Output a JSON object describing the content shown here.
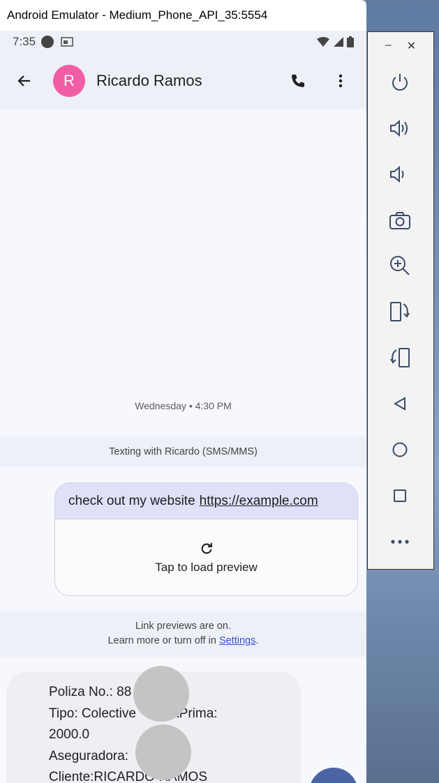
{
  "window": {
    "title": "Android Emulator - Medium_Phone_API_35:5554"
  },
  "status_bar": {
    "time": "7:35"
  },
  "app_bar": {
    "avatar_letter": "R",
    "contact_name": "Ricardo Ramos"
  },
  "conversation": {
    "date_separator": "Wednesday • 4:30 PM",
    "texting_with": "Texting with Ricardo (SMS/MMS)",
    "outgoing": {
      "text": "check out my website",
      "link": "https://example.com",
      "preview_label": "Tap to load preview"
    },
    "link_notice": {
      "line1": "Link previews are on.",
      "line2_prefix": "Learn more or turn off in ",
      "settings_link": "Settings",
      "line2_suffix": "."
    },
    "incoming": {
      "lines": [
        "Poliza No.: 88",
        "Tipo: Colective",
        "ndaPrima:",
        "2000.0",
        "Aseguradora:",
        "Cliente:RICARDO RAMOS"
      ]
    }
  },
  "side_panel": {
    "minimize": "–",
    "close": "✕",
    "buttons": [
      "power-icon",
      "volume-up-icon",
      "volume-down-icon",
      "camera-icon",
      "zoom-in-icon",
      "rotate-left-icon",
      "rotate-right-icon",
      "back-icon",
      "home-icon",
      "overview-icon",
      "more-icon"
    ]
  },
  "colors": {
    "avatar": "#f25ea6",
    "accent": "#3d4fc7",
    "outgoing_bubble": "#dfe1f8"
  }
}
